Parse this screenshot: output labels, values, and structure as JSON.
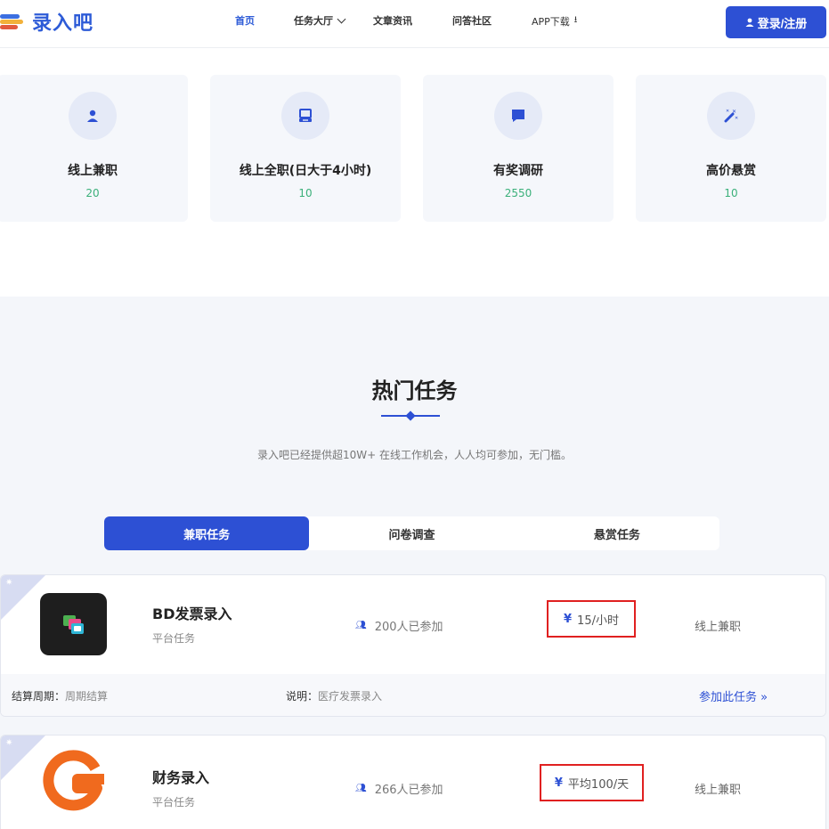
{
  "header": {
    "logo_text": "录入吧",
    "nav": [
      {
        "label": "首页"
      },
      {
        "label": "任务大厅"
      },
      {
        "label": "文章资讯"
      },
      {
        "label": "问答社区"
      },
      {
        "label": "APP下载"
      }
    ],
    "login_label": "登录/注册"
  },
  "categories": [
    {
      "title": "线上兼职",
      "count": "20",
      "icon": "user-icon"
    },
    {
      "title": "线上全职(日大于4小时)",
      "count": "10",
      "icon": "laptop-icon"
    },
    {
      "title": "有奖调研",
      "count": "2550",
      "icon": "chat-icon"
    },
    {
      "title": "高价悬赏",
      "count": "10",
      "icon": "magic-wand-icon"
    }
  ],
  "hot": {
    "title": "热门任务",
    "subtitle": "录入吧已经提供超10W+ 在线工作机会，人人均可参加，无门槛。",
    "tabs": [
      {
        "label": "兼职任务"
      },
      {
        "label": "问卷调查"
      },
      {
        "label": "悬赏任务"
      }
    ]
  },
  "tasks": [
    {
      "name": "BD发票录入",
      "type": "平台任务",
      "joined": "200人已参加",
      "price": "15/小时",
      "category": "线上兼职",
      "settle_label": "结算周期：",
      "settle_value": "周期结算",
      "desc_label": "说明：",
      "desc_value": "医疗发票录入",
      "join_label": "参加此任务 »"
    },
    {
      "name": "财务录入",
      "type": "平台任务",
      "joined": "266人已参加",
      "price": "平均100/天",
      "category": "线上兼职"
    }
  ],
  "colors": {
    "brand": "#2d50d4",
    "count_green": "#3bb07a",
    "highlight_red": "#e02020"
  }
}
